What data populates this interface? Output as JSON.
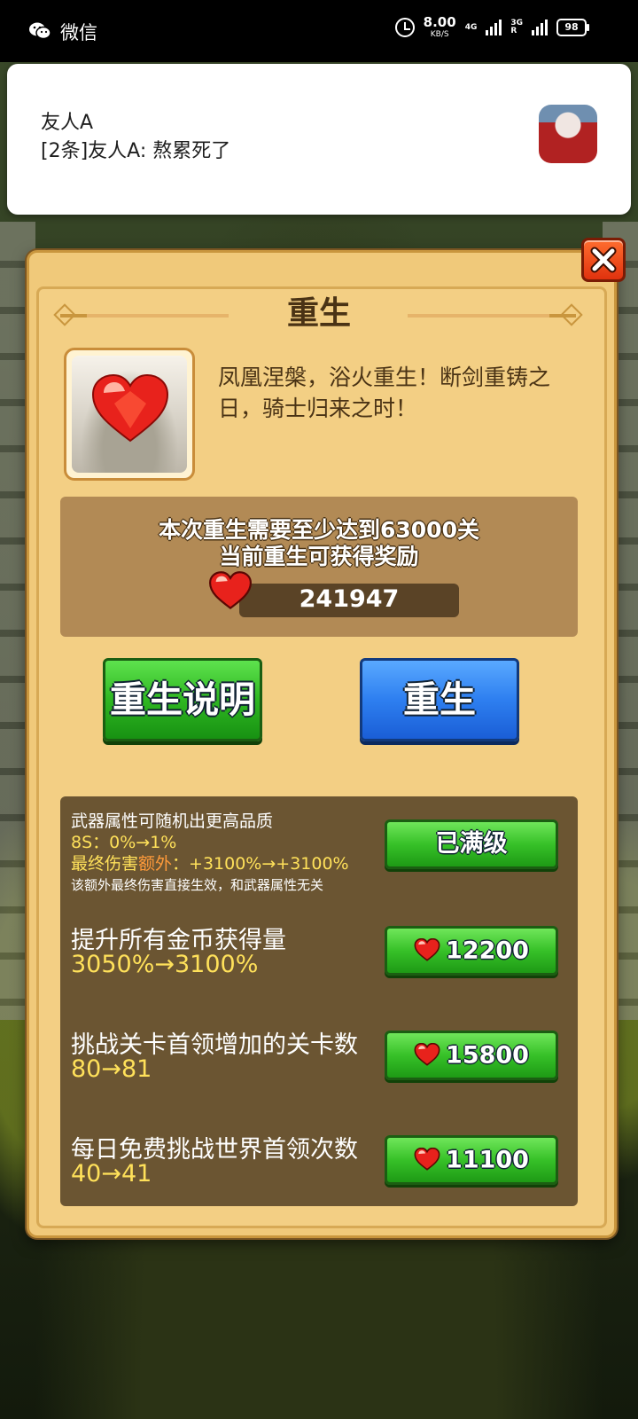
{
  "status_bar": {
    "app_name": "微信",
    "speed_value": "8.00",
    "speed_unit": "KB/S",
    "network_1": "4G",
    "network_2": "3G",
    "network_2_sub": "R",
    "battery": "98"
  },
  "notification": {
    "title": "友人A",
    "body": "[2条]友人A: 熬累死了"
  },
  "popup": {
    "title": "重生",
    "description": "凤凰涅槃，浴火重生！断剑重铸之日，骑士归来之时！",
    "requirement_line1": "本次重生需要至少达到63000关",
    "requirement_line2": "当前重生可获得奖励",
    "reward_value": "241947",
    "info_button": "重生说明",
    "rebirth_button": "重生"
  },
  "upgrades": [
    {
      "line1": "武器属性可随机出更高品质",
      "line2": "8S：0%→1%",
      "line3_prefix": "最终伤害",
      "line3_highlight": "额外",
      "line3_suffix": "：+3100%→+3100%",
      "line4": "该额外最终伤害直接生效，和武器属性无关",
      "button": "已满级"
    },
    {
      "title": "提升所有金币获得量",
      "change": "3050%→3100%",
      "cost": "12200"
    },
    {
      "title": "挑战关卡首领增加的关卡数",
      "change": "80→81",
      "cost": "15800"
    },
    {
      "title": "每日免费挑战世界首领次数",
      "change": "40→41",
      "cost": "11100"
    }
  ],
  "colors": {
    "panel": "#f3cf84",
    "green_button": "#2fb722",
    "blue_button": "#2e7ff0",
    "close_button": "#e0320e",
    "highlight_yellow": "#ffe15a"
  }
}
